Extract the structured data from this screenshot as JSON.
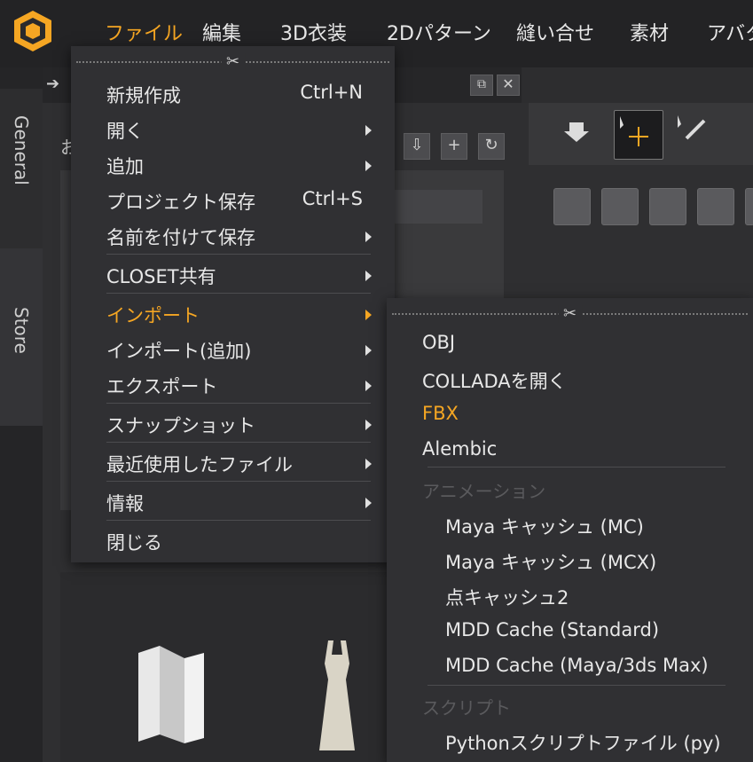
{
  "menubar": {
    "items": [
      "ファイル",
      "編集",
      "3D衣装",
      "2Dパターン",
      "縫い合せ",
      "素材",
      "アバタ"
    ],
    "active_index": 0
  },
  "sidebar": {
    "tabs": [
      "General",
      "Store"
    ]
  },
  "library_panel": {
    "title_partial": "お"
  },
  "file_menu": {
    "items": [
      {
        "label": "新規作成",
        "shortcut": "Ctrl+N"
      },
      {
        "label": "開く",
        "submenu": true
      },
      {
        "label": "追加",
        "submenu": true
      },
      {
        "label": "プロジェクト保存",
        "shortcut": "Ctrl+S"
      },
      {
        "label": "名前を付けて保存",
        "submenu": true
      },
      {
        "label": "CLOSET共有",
        "submenu": true
      },
      {
        "label": "インポート",
        "submenu": true,
        "active": true
      },
      {
        "label": "インポート(追加)",
        "submenu": true
      },
      {
        "label": "エクスポート",
        "submenu": true
      },
      {
        "label": "スナップショット",
        "submenu": true
      },
      {
        "label": "最近使用したファイル",
        "submenu": true
      },
      {
        "label": "情報",
        "submenu": true
      },
      {
        "label": "閉じる"
      }
    ]
  },
  "import_submenu": {
    "items": [
      "OBJ",
      "COLLADAを開く",
      "FBX",
      "Alembic"
    ],
    "animation_header": "アニメーション",
    "animation_items": [
      "Maya キャッシュ (MC)",
      "Maya キャッシュ (MCX)",
      "点キャッシュ2",
      "MDD Cache (Standard)",
      "MDD Cache (Maya/3ds Max)"
    ],
    "script_header": "スクリプト",
    "script_items": [
      "Pythonスクリプトファイル (py)"
    ]
  },
  "colors": {
    "accent": "#f5a623",
    "menu_bg": "#303033",
    "header_disabled": "#5a5a5d"
  },
  "icons": [
    "app-logo-icon",
    "scissors-icon",
    "arrow-right-icon",
    "popout-icon",
    "close-icon",
    "download-icon",
    "plus-icon",
    "refresh-icon",
    "move-tool-icon",
    "pen-tool-icon",
    "folder-icon",
    "dress-icon"
  ]
}
